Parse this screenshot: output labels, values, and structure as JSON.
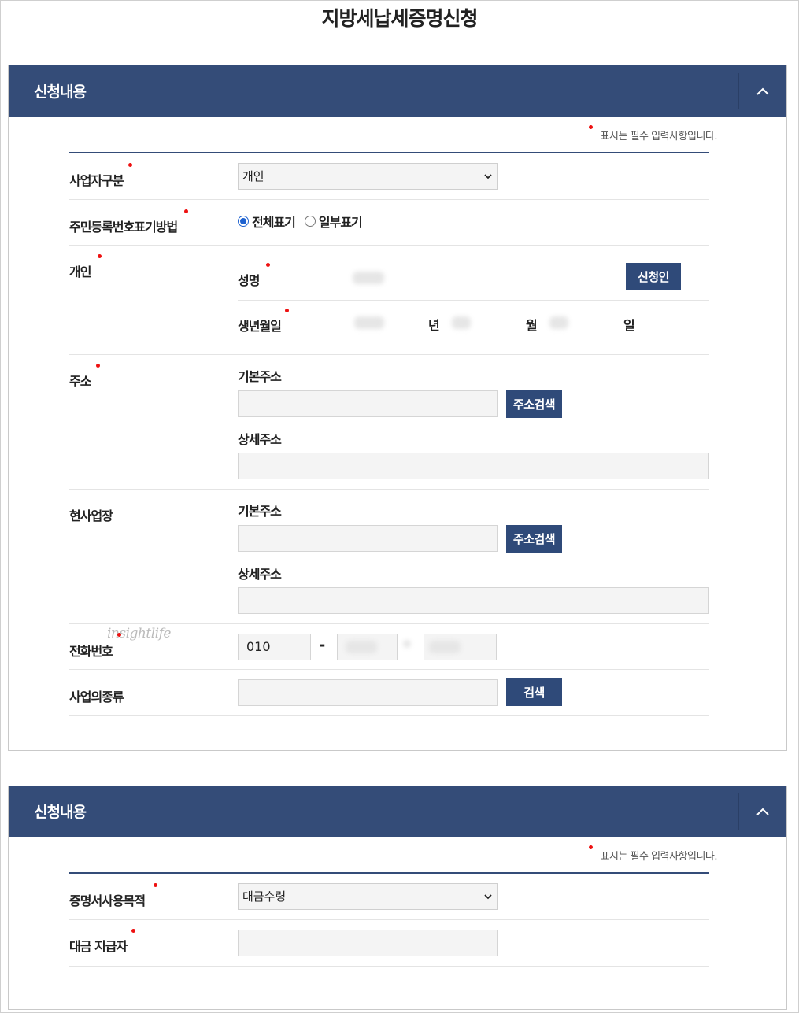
{
  "page_title": "지방세납세증명신청",
  "section1": {
    "title": "신청내용",
    "required_note": "표시는 필수 입력사항입니다.",
    "business_type": {
      "label": "사업자구분",
      "value": "개인"
    },
    "rrn_method": {
      "label": "주민등록번호표기방법",
      "options": [
        "전체표기",
        "일부표기"
      ],
      "selected": "전체표기"
    },
    "person": {
      "label": "개인",
      "name_label": "성명",
      "applicant_button": "신청인",
      "birth_label": "생년월일",
      "year_unit": "년",
      "month_unit": "월",
      "day_unit": "일"
    },
    "address": {
      "label": "주소",
      "basic_label": "기본주소",
      "detail_label": "상세주소",
      "search_button": "주소검색"
    },
    "workplace": {
      "label": "현사업장",
      "basic_label": "기본주소",
      "detail_label": "상세주소",
      "search_button": "주소검색"
    },
    "phone": {
      "label": "전화번호",
      "first": "010",
      "dash": "-"
    },
    "business_kind": {
      "label": "사업의종류",
      "search_button": "검색"
    },
    "watermark": "insightlife"
  },
  "section2": {
    "title": "신청내용",
    "required_note": "표시는 필수 입력사항입니다.",
    "purpose": {
      "label": "증명서사용목적",
      "value": "대금수령"
    },
    "payer": {
      "label": "대금 지급자"
    }
  },
  "colors": {
    "header": "#344c78",
    "button": "#2f4a79",
    "required_dot": "#ee1111",
    "radio": "#1e62d0"
  }
}
